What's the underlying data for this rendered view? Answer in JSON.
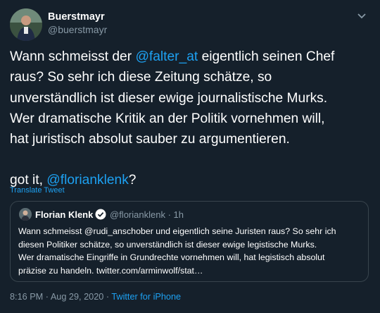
{
  "tweet": {
    "display_name": "Buerstmayr",
    "handle": "@buerstmayr",
    "menu_icon": "chevron-down-icon",
    "body_lines": {
      "l1_pre": "Wann schmeisst der ",
      "l1_mention": "@falter_at",
      "l1_post": " eigentlich seinen Chef",
      "l2": "raus? So sehr ich diese Zeitung schätze, so",
      "l3": "unverständlich  ist dieser ewige journalistische Murks.",
      "l4": "Wer dramatische Kritik an der Politik vornehmen will,",
      "l5": "hat juristisch absolut sauber zu argumentieren.",
      "l6_pre": "got it, ",
      "l6_mention": "@florianklenk",
      "l6_post": "?"
    },
    "translate_label": "Translate Tweet",
    "timestamp": "8:16 PM · Aug 29, 2020",
    "separator": " · ",
    "source": "Twitter for iPhone"
  },
  "quoted_tweet": {
    "display_name": "Florian Klenk",
    "verified_icon": "verified-badge-icon",
    "handle_time": "@florianklenk · 1h",
    "lines": [
      "Wann schmeisst @rudi_anschober und eigentlich seine Juristen raus? So sehr ich",
      "diesen Politiker schätze, so unverständlich  ist dieser ewige legistische Murks.",
      "Wer dramatische Eingriffe in Grundrechte vornehmen will, hat legistisch absolut",
      "präzise zu handeln. twitter.com/arminwolf/stat…"
    ]
  },
  "colors": {
    "background": "#15202b",
    "link": "#1da1f2",
    "muted": "#8899a6",
    "border": "#38444d"
  }
}
